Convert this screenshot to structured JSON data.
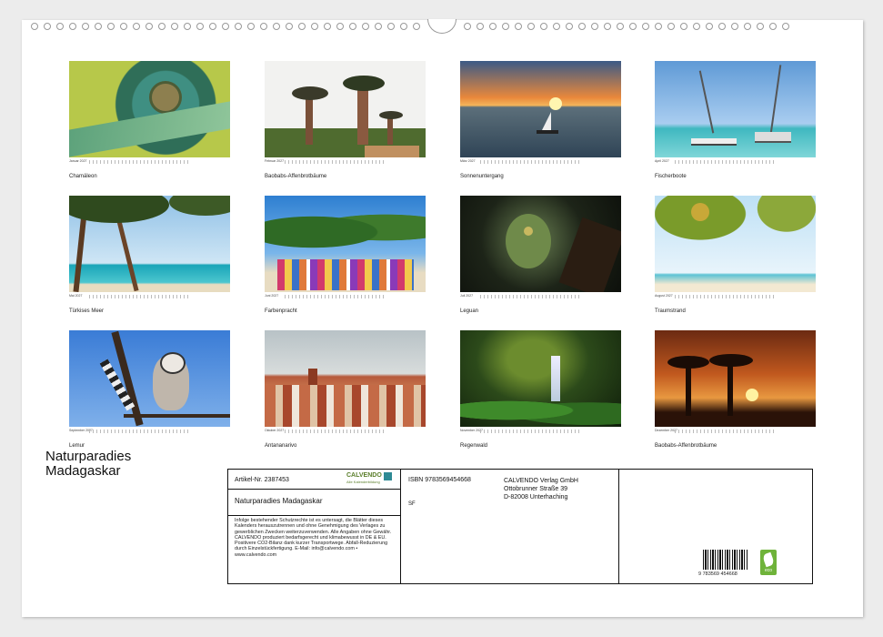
{
  "title_lines": [
    "Naturparadies",
    "Madagaskar"
  ],
  "tiles": [
    {
      "month": "Januar 2027",
      "caption": "Chamäleon"
    },
    {
      "month": "Februar 2027",
      "caption": "Baobabs-Affenbrotbäume"
    },
    {
      "month": "März 2027",
      "caption": "Sonnenuntergang"
    },
    {
      "month": "April 2027",
      "caption": "Fischerboote"
    },
    {
      "month": "Mai 2027",
      "caption": "Türkises Meer"
    },
    {
      "month": "Juni 2027",
      "caption": "Farbenpracht"
    },
    {
      "month": "Juli 2027",
      "caption": "Leguan"
    },
    {
      "month": "August 2027",
      "caption": "Traumstrand"
    },
    {
      "month": "September 2027",
      "caption": "Lemur"
    },
    {
      "month": "Oktober 2027",
      "caption": "Antananarivo"
    },
    {
      "month": "November 2027",
      "caption": "Regenwald"
    },
    {
      "month": "Dezember 2027",
      "caption": "Baobabs-Affenbrotbäume"
    }
  ],
  "info": {
    "article_no": "Artikel-Nr. 2387453",
    "calvendo_logo": "CALVENDO",
    "calvendo_tagline": "Alle Kalenderbildung",
    "product_title": "Naturparadies Madagaskar",
    "legal_text": "Infolge bestehender Schutzrechte ist es untersagt, die Blätter dieses Kalenders herauszutrennen und ohne Genehmigung des Verlages zu gewerblichen Zwecken weiterzuverwenden. Alle Angaben ohne Gewähr. CALVENDO produziert bedarfsgerecht und klimabewusst in DE & EU. Positivere CO2-Bilanz dank kurzer Transportwege. Abfall-Reduzierung durch Einzelstückfertigung. E-Mail: info@calvendo.com • www.calvendo.com",
    "isbn": "ISBN 9783569454668",
    "format_code": "SF",
    "publisher_lines": [
      "CALVENDO Verlag GmbH",
      "Ottobrunner Straße 39",
      "D-82008 Unterhaching"
    ],
    "barcode_digits": "9 783569 454668",
    "eco_label": "eco"
  },
  "colors": {
    "eco_green": "#6fb33a",
    "calvendo_green": "#5a7e2a"
  }
}
